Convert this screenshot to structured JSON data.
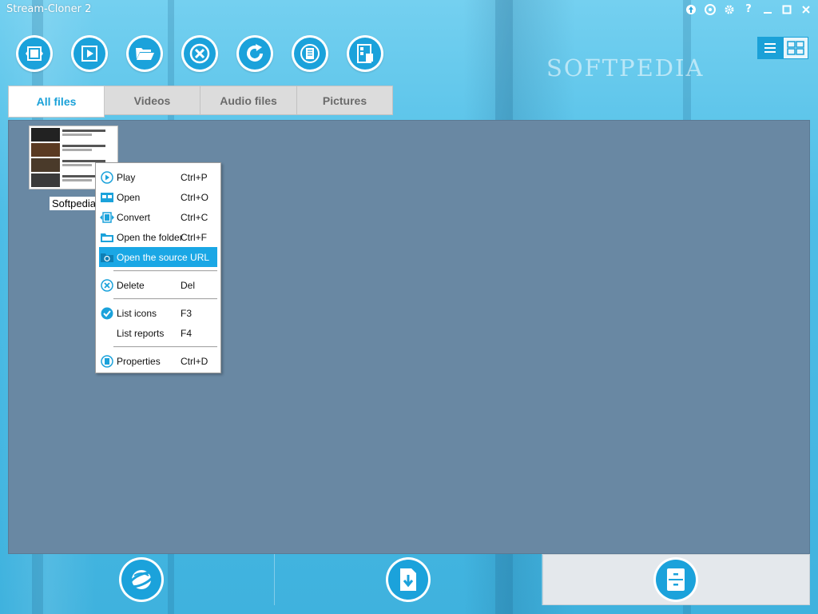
{
  "app": {
    "title": "Stream-Cloner 2"
  },
  "titlebar": {
    "buttons": [
      {
        "name": "upgrade-icon",
        "glyph": "⬆"
      },
      {
        "name": "network-settings-icon",
        "glyph": "⚙"
      },
      {
        "name": "settings-icon",
        "glyph": "⚙"
      },
      {
        "name": "help-icon",
        "glyph": "?"
      },
      {
        "name": "minimize-icon",
        "glyph": "–"
      },
      {
        "name": "maximize-icon",
        "glyph": "□"
      },
      {
        "name": "close-icon",
        "glyph": "✕"
      }
    ]
  },
  "watermark": "SOFTPEDIA",
  "toolbar": {
    "buttons": [
      {
        "name": "convert-video-icon"
      },
      {
        "name": "play-icon"
      },
      {
        "name": "open-folder-icon"
      },
      {
        "name": "delete-icon"
      },
      {
        "name": "refresh-icon"
      },
      {
        "name": "properties-icon"
      },
      {
        "name": "file-report-icon"
      }
    ]
  },
  "view_toggle": {
    "options": [
      "list-view-icon",
      "grid-view-icon"
    ],
    "selected": "grid-view-icon"
  },
  "tabs": [
    {
      "label": "All files",
      "active": true
    },
    {
      "label": "Videos",
      "active": false
    },
    {
      "label": "Audio files",
      "active": false
    },
    {
      "label": "Pictures",
      "active": false
    }
  ],
  "file": {
    "label": "Softpedia"
  },
  "context_menu": {
    "items": [
      {
        "label": "Play",
        "shortcut": "Ctrl+P",
        "icon": "play-icon"
      },
      {
        "label": "Open",
        "shortcut": "Ctrl+O",
        "icon": "open-icon"
      },
      {
        "label": "Convert",
        "shortcut": "Ctrl+C",
        "icon": "convert-icon"
      },
      {
        "label": "Open the folder",
        "shortcut": "Ctrl+F",
        "icon": "folder-icon"
      },
      {
        "label": "Open the source URL",
        "shortcut": "",
        "icon": "source-url-icon",
        "highlighted": true
      },
      {
        "label": "Delete",
        "shortcut": "Del",
        "icon": "delete-icon"
      },
      {
        "label": "List icons",
        "shortcut": "F3",
        "icon": "check-icon",
        "checked": true
      },
      {
        "label": "List reports",
        "shortcut": "F4",
        "icon": ""
      },
      {
        "label": "Properties",
        "shortcut": "Ctrl+D",
        "icon": "properties-icon"
      }
    ]
  },
  "bottom_nav": [
    {
      "name": "browser-icon",
      "selected": false
    },
    {
      "name": "download-icon",
      "selected": false
    },
    {
      "name": "library-icon",
      "selected": true
    }
  ],
  "colors": {
    "accent": "#1ba2db",
    "highlight": "#1aa7e5",
    "content_bg": "#6988a3"
  }
}
